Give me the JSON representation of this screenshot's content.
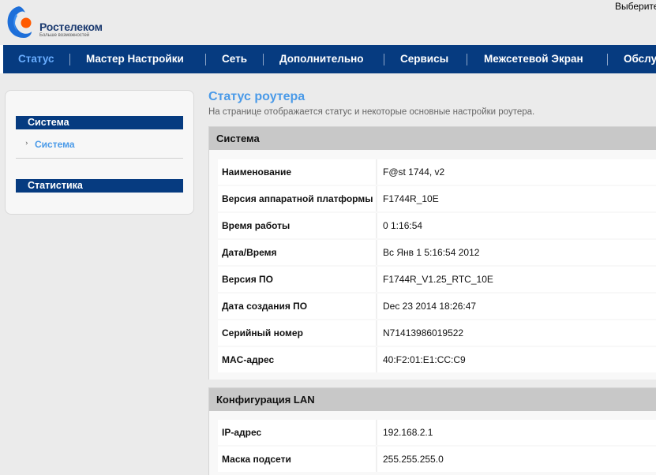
{
  "header": {
    "logo_name": "Ростелеком",
    "logo_tagline": "Больше возможностей",
    "lang_prompt": "Выберите"
  },
  "nav": {
    "items": [
      {
        "label": "Статус",
        "active": true
      },
      {
        "label": "Мастер Настройки"
      },
      {
        "label": "Сеть"
      },
      {
        "label": "Дополнительно"
      },
      {
        "label": "Сервисы"
      },
      {
        "label": "Межсетевой Экран"
      },
      {
        "label": "Обслу"
      }
    ]
  },
  "sidebar": {
    "groups": [
      {
        "title": "Система",
        "items": [
          "Система"
        ]
      },
      {
        "title": "Статистика"
      }
    ]
  },
  "main": {
    "title": "Статус роутера",
    "description": "На странице отображается статус и некоторые основные настройки роутера.",
    "sections": [
      {
        "title": "Система",
        "rows": [
          {
            "label": "Наименование",
            "value": "F@st 1744, v2"
          },
          {
            "label": "Версия аппаратной платформы",
            "value": "F1744R_10E"
          },
          {
            "label": "Время работы",
            "value": "0 1:16:54"
          },
          {
            "label": "Дата/Время",
            "value": "Вс Янв 1 5:16:54 2012"
          },
          {
            "label": "Версия ПО",
            "value": "F1744R_V1.25_RTC_10E"
          },
          {
            "label": "Дата создания ПО",
            "value": "Dec 23 2014 18:26:47"
          },
          {
            "label": "Серийный номер",
            "value": "N71413986019522"
          },
          {
            "label": "MAC-адрес",
            "value": "40:F2:01:E1:CC:C9"
          }
        ]
      },
      {
        "title": "Конфигурация LAN",
        "rows": [
          {
            "label": "IP-адрес",
            "value": "192.168.2.1"
          },
          {
            "label": "Маска подсети",
            "value": "255.255.255.0"
          }
        ]
      }
    ]
  },
  "colors": {
    "nav_bg": "#063b80",
    "accent": "#4a9ae8",
    "active_nav": "#6aaeff"
  },
  "icons": {
    "logo": "rostelecom-logo-icon",
    "sidebar_bullet": "chevron-right-icon"
  }
}
